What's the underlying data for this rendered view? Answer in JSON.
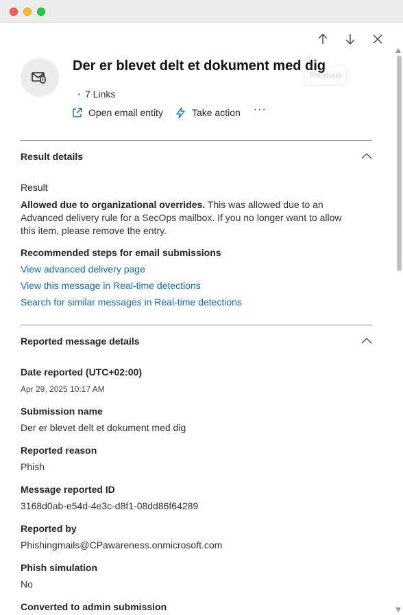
{
  "window": {
    "controls": [
      "close",
      "minimize",
      "zoom"
    ]
  },
  "nav": {
    "up_icon": "arrow-up-icon",
    "down_icon": "arrow-down-icon",
    "close_icon": "close-icon",
    "tooltip": "Previous"
  },
  "header": {
    "avatar_icon": "mail-attachment-icon",
    "title": "Der er blevet delt et dokument med dig",
    "links": "7 Links",
    "open_email_entity": "Open email entity",
    "take_action": "Take action",
    "more": "···"
  },
  "result_details": {
    "section_title": "Result details",
    "result_label": "Result",
    "result_bold": "Allowed due to organizational overrides.",
    "result_text": " This was allowed due to an Advanced delivery rule for a SecOps mailbox. If you no longer want to allow this item, please remove the entry.",
    "steps_label": "Recommended steps for email submissions",
    "links": [
      "View advanced delivery page",
      "View this message in Real-time detections",
      "Search for similar messages in Real-time detections"
    ]
  },
  "reported_message_details": {
    "section_title": "Reported message details",
    "fields": [
      {
        "label": "Date reported (UTC+02:00)",
        "value": "Apr 29, 2025 10:17 AM"
      },
      {
        "label": "Submission name",
        "value": "Der er blevet delt et dokument med dig"
      },
      {
        "label": "Reported reason",
        "value": "Phish"
      },
      {
        "label": "Message reported ID",
        "value": "3168d0ab-e54d-4e3c-d8f1-08dd86f64289"
      },
      {
        "label": "Reported by",
        "value": "Phishingmails@CPawareness.onmicrosoft.com"
      },
      {
        "label": "Phish simulation",
        "value": "No"
      },
      {
        "label": "Converted to admin submission",
        "value": ""
      }
    ]
  },
  "colors": {
    "link": "#0f6cbd",
    "divider": "#8a8886",
    "avatar_bg": "#ececec"
  }
}
